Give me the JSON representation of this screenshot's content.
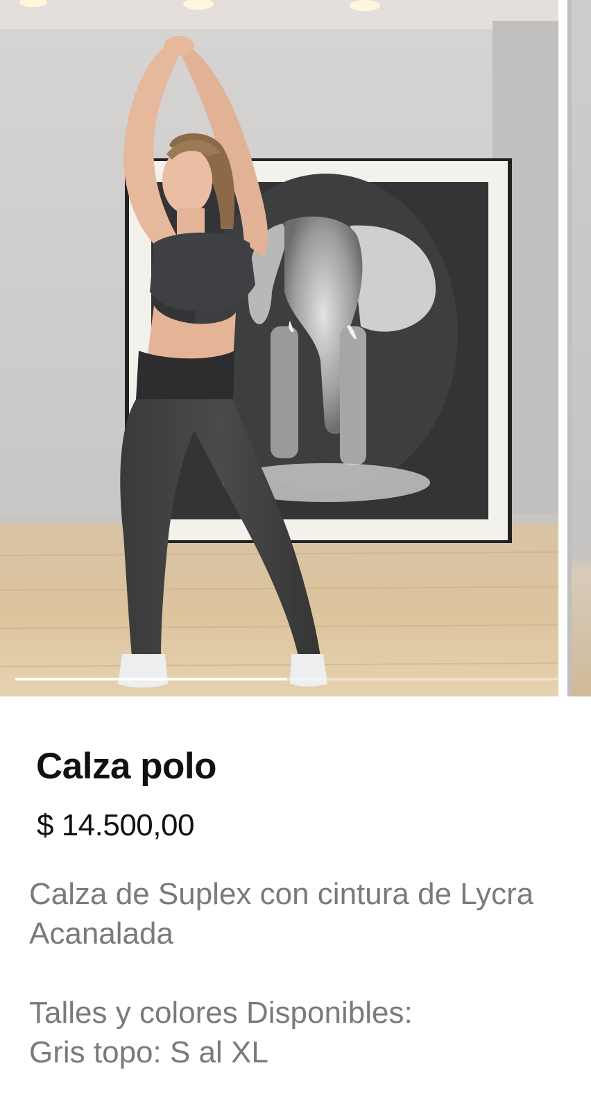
{
  "carousel": {
    "image_description_icon": "product-photo",
    "progress_fraction": 0.5
  },
  "product": {
    "title": "Calza polo",
    "price": "$ 14.500,00",
    "description_lines": [
      "Calza de Suplex con cintura de Lycra",
      "Acanalada",
      "Talles y colores Disponibles:",
      "Gris topo: S al XL"
    ]
  }
}
